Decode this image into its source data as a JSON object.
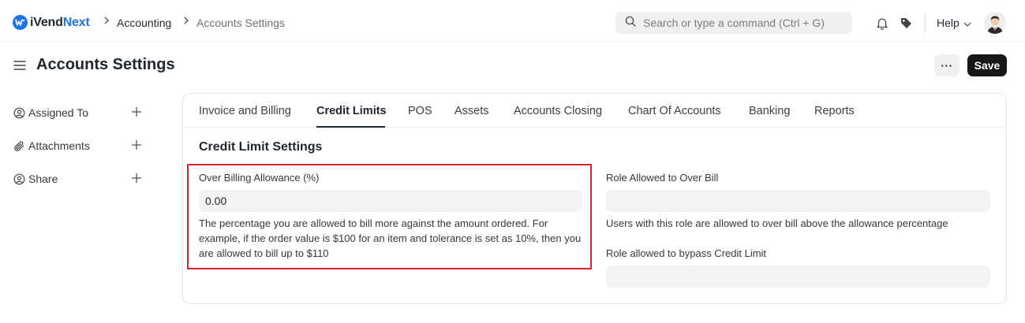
{
  "app": {
    "logo_main": "iVend",
    "logo_accent": "Next",
    "logo_mark": "iv",
    "brand_color": "#1a73e8"
  },
  "breadcrumb": [
    "Accounting",
    "Accounts Settings"
  ],
  "search": {
    "placeholder": "Search or type a command (Ctrl + G)"
  },
  "navbar": {
    "help_label": "Help",
    "icons": [
      "bell-icon",
      "tag-icon",
      "chevron-down-icon",
      "avatar"
    ]
  },
  "page": {
    "title": "Accounts Settings",
    "more_label": "···",
    "save_label": "Save"
  },
  "sidebar": {
    "items": [
      {
        "label": "Assigned To",
        "icon": "user-circle-icon"
      },
      {
        "label": "Attachments",
        "icon": "paperclip-icon"
      },
      {
        "label": "Share",
        "icon": "user-circle-icon"
      }
    ]
  },
  "tabs": [
    {
      "label": "Invoice and Billing",
      "active": false
    },
    {
      "label": "Credit Limits",
      "active": true
    },
    {
      "label": "POS",
      "active": false
    },
    {
      "label": "Assets",
      "active": false
    },
    {
      "label": "Accounts Closing",
      "active": false
    },
    {
      "label": "Chart Of Accounts",
      "active": false
    },
    {
      "label": "Banking",
      "active": false
    },
    {
      "label": "Reports",
      "active": false
    }
  ],
  "section": {
    "title": "Credit Limit Settings",
    "over_billing": {
      "label": "Over Billing Allowance (%)",
      "value": "0.00",
      "description": "The percentage you are allowed to bill more against the amount ordered. For example, if the order value is $100 for an item and tolerance is set as 10%, then you are allowed to bill up to $110"
    },
    "role_over_bill": {
      "label": "Role Allowed to Over Bill",
      "value": "",
      "description": "Users with this role are allowed to over bill above the allowance percentage"
    },
    "role_bypass": {
      "label": "Role allowed to bypass Credit Limit",
      "value": ""
    }
  },
  "colors": {
    "highlight": "#d6232f",
    "save_bg": "#171717",
    "input_bg": "#f3f3f3"
  }
}
